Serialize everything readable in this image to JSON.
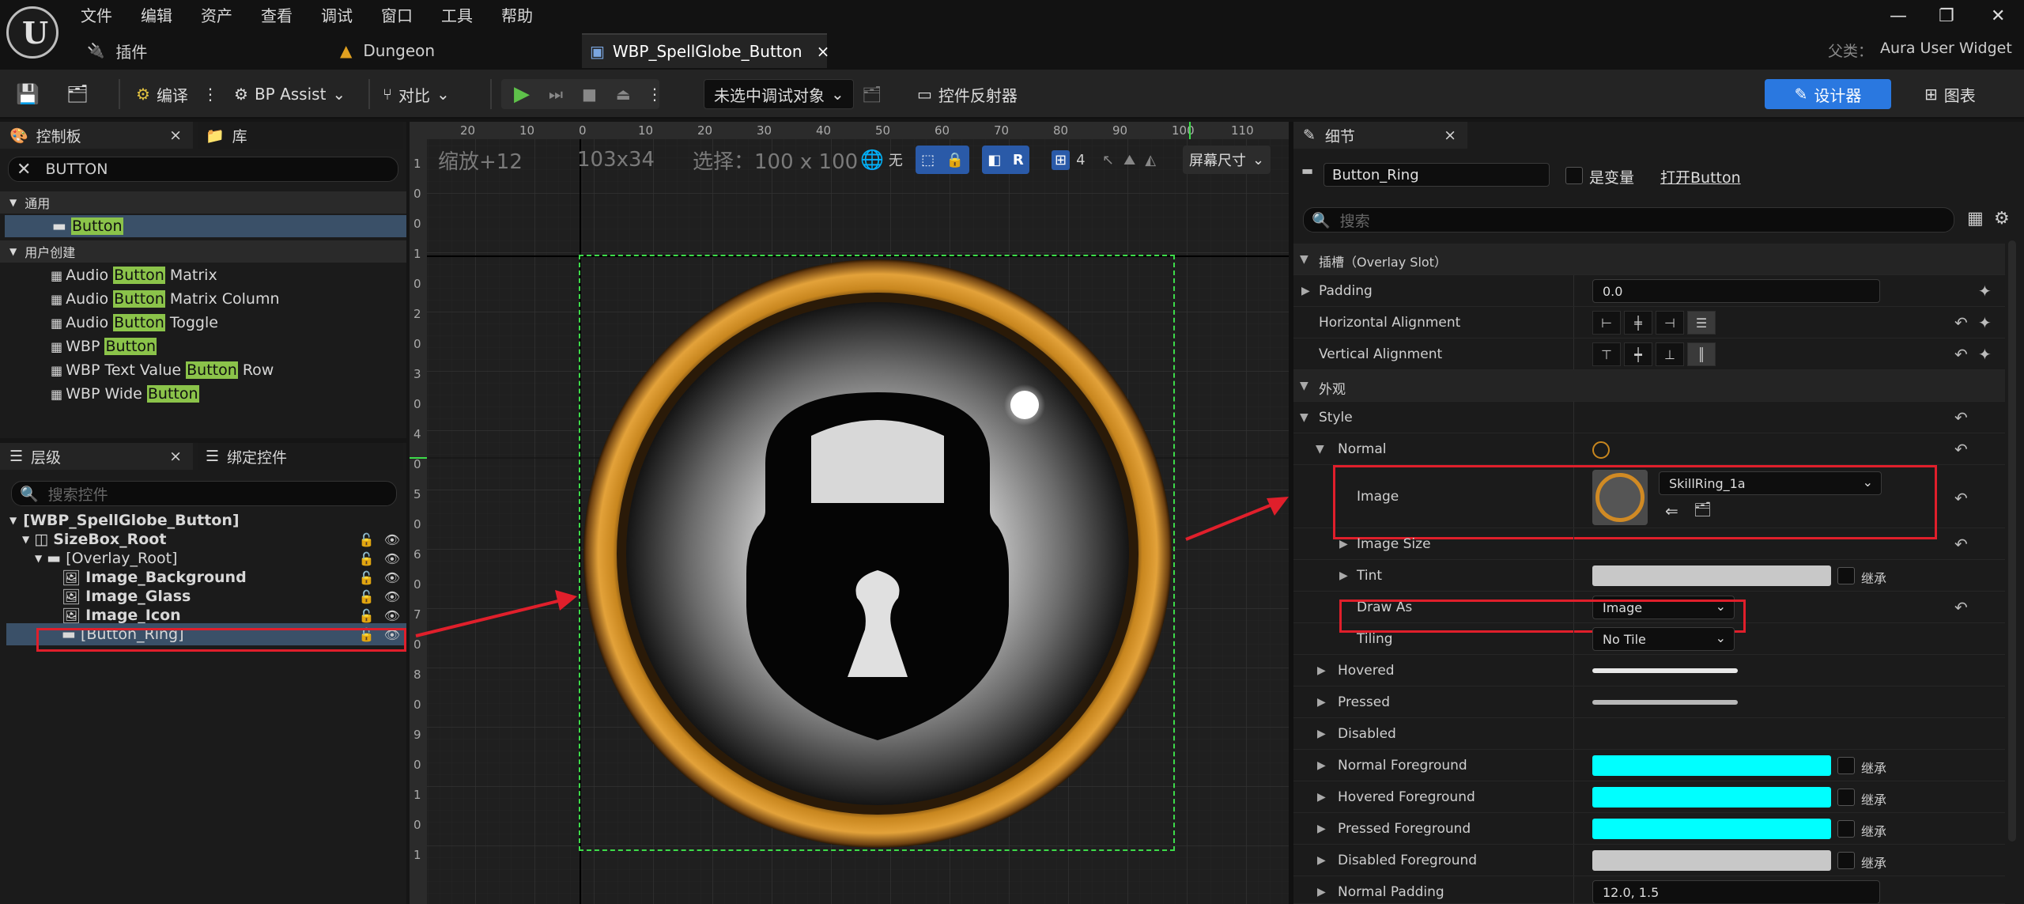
{
  "menu": [
    "文件",
    "编辑",
    "资产",
    "查看",
    "调试",
    "窗口",
    "工具",
    "帮助"
  ],
  "tabs": {
    "plugins": "插件",
    "dungeon": "Dungeon",
    "widget": "WBP_SpellGlobe_Button",
    "close": "×"
  },
  "parent_label": "父类：",
  "parent_value": "Aura User Widget",
  "toolbar": {
    "compile": "编译",
    "bp_assist": "BP Assist",
    "diff": "对比",
    "debug_target": "未选中调试对象",
    "widget_reflector": "控件反射器",
    "designer": "设计器",
    "graph": "图表"
  },
  "palette": {
    "title": "控制板",
    "library": "库",
    "close": "×",
    "search_value": "BUTTON",
    "cat_common": "通用",
    "common_item": "Button",
    "cat_user": "用户创建",
    "user_items": [
      {
        "pre": "Audio ",
        "hl": "Button",
        "post": " Matrix"
      },
      {
        "pre": "Audio ",
        "hl": "Button",
        "post": " Matrix Column"
      },
      {
        "pre": "Audio ",
        "hl": "Button",
        "post": " Toggle"
      },
      {
        "pre": "WBP ",
        "hl": "Button",
        "post": ""
      },
      {
        "pre": "WBP Text Value ",
        "hl": "Button",
        "post": " Row"
      },
      {
        "pre": "WBP Wide ",
        "hl": "Button",
        "post": ""
      }
    ]
  },
  "hierarchy": {
    "title": "层级",
    "bind": "绑定控件",
    "close": "×",
    "search_placeholder": "搜索控件",
    "items": [
      "[WBP_SpellGlobe_Button]",
      "SizeBox_Root",
      "[Overlay_Root]",
      "Image_Background",
      "Image_Glass",
      "Image_Icon",
      "[Button_Ring]"
    ]
  },
  "viewport": {
    "zoom": "缩放+12",
    "size": "103x34",
    "selection": "选择：100 x 100",
    "none": "无",
    "grid": "4",
    "screen_size": "屏幕尺寸",
    "ruler_top": [
      "20",
      "10",
      "0",
      "10",
      "20",
      "30",
      "40",
      "50",
      "60",
      "70",
      "80",
      "90",
      "100",
      "110"
    ],
    "ruler_left": [
      "1",
      "0",
      "0",
      "1",
      "0",
      "2",
      "0",
      "3",
      "0",
      "4",
      "0",
      "5",
      "0",
      "6",
      "0",
      "7",
      "0",
      "8",
      "0",
      "9",
      "0",
      "1",
      "0",
      "1"
    ]
  },
  "details": {
    "title": "细节",
    "close": "×",
    "widget_name": "Button_Ring",
    "is_variable": "是变量",
    "open_button": "打开Button",
    "search_placeholder": "搜索",
    "slot_section": "插槽（Overlay Slot）",
    "padding_label": "Padding",
    "padding_value": "0.0",
    "h_align": "Horizontal Alignment",
    "v_align": "Vertical Alignment",
    "appearance": "外观",
    "style": "Style",
    "normal": "Normal",
    "image": "Image",
    "image_asset": "SkillRing_1a",
    "image_size": "Image Size",
    "tint": "Tint",
    "inherit": "继承",
    "draw_as": "Draw As",
    "draw_as_value": "Image",
    "tiling": "Tiling",
    "tiling_value": "No Tile",
    "hovered": "Hovered",
    "pressed": "Pressed",
    "disabled": "Disabled",
    "normal_fg": "Normal Foreground",
    "hovered_fg": "Hovered Foreground",
    "pressed_fg": "Pressed Foreground",
    "disabled_fg": "Disabled Foreground",
    "normal_padding": "Normal Padding",
    "normal_padding_value": "12.0, 1.5"
  },
  "colors": {
    "accent": "#2a78e0",
    "highlight": "#8bc34a",
    "cyan": "#00ffff",
    "red": "#e01f2b",
    "selection_green": "#3ddc4a"
  }
}
